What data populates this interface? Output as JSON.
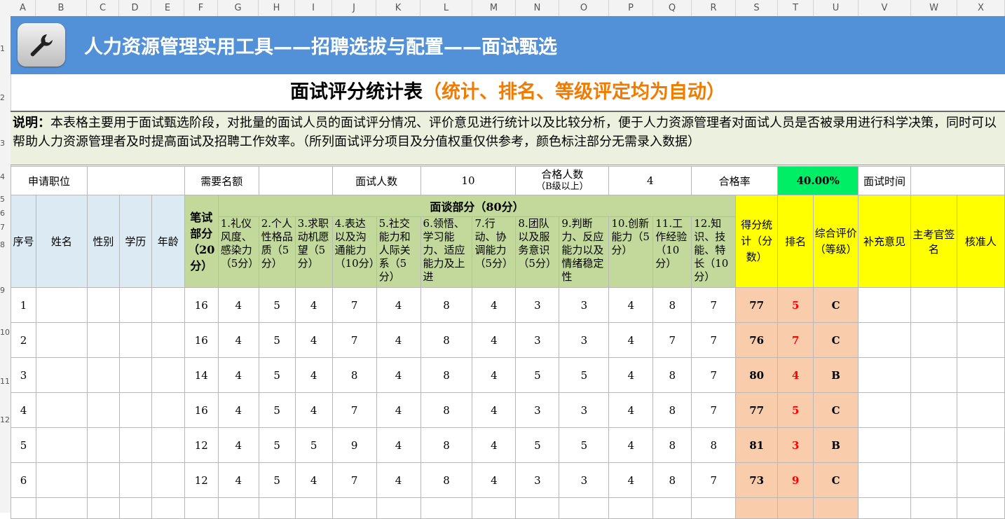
{
  "columns": [
    "A",
    "B",
    "C",
    "D",
    "E",
    "F",
    "G",
    "H",
    "I",
    "J",
    "K",
    "L",
    "M",
    "N",
    "O",
    "P",
    "Q",
    "R",
    "S",
    "T",
    "U",
    "V",
    "W",
    "X"
  ],
  "row_numbers": [
    "1",
    "2",
    "3",
    "4",
    "5",
    "6",
    "7",
    "8",
    "9",
    "10",
    "11",
    "12"
  ],
  "banner_title": "人力资源管理实用工具——招聘选拔与配置——面试甄选",
  "sheet_title": {
    "main": "面试评分统计表",
    "sub": "（统计、排名、等级评定均为自动）"
  },
  "note": {
    "label": "说明：",
    "text": "本表格主要用于面试甄选阶段，对批量的面试人员的面试评分情况、评价意见进行统计以及比较分析，便于人力资源管理者对面试人员是否被录用进行科学决策，同时可以帮助人力资源管理者及时提高面试及招聘工作效率。（所列面试评分项目及分值权重仅供参考，颜色标注部分无需录入数据）"
  },
  "info": {
    "position_label": "申请职位",
    "position_value": "",
    "quota_label": "需要名额",
    "quota_value": "",
    "count_label": "面试人数",
    "count_value": "10",
    "pass_label_1": "合格人数",
    "pass_label_2": "（B级以上）",
    "pass_value": "4",
    "rate_label": "合格率",
    "rate_value": "40.00%",
    "time_label": "面试时间",
    "time_value": ""
  },
  "headers": {
    "seq": "序号",
    "name": "姓名",
    "gender": "性别",
    "edu": "学历",
    "age": "年龄",
    "written": "笔试部分（20分）",
    "interview": "面谈部分（80分）",
    "items": [
      "1.礼仪风度、感染力（5分）",
      "2.个人性格品质（5分）",
      "3.求职动机愿望（5分）",
      "4.表达以及沟通能力（10分）",
      "5.社交能力和人际关系（5分）",
      "6.领悟、学习能力、适应能力及上进",
      "7.行动、协调能力（5分）",
      "8.团队以及服务意识（5分）",
      "9.判断力、反应能力以及情绪稳定性",
      "10.创新能力（5分）",
      "11.工作经验（10分）",
      "12.知识、技能、特长（10分）"
    ],
    "total": "得分统计（分数）",
    "rank": "排名",
    "grade": "综合评价（等级）",
    "extra": "补充意见",
    "examiner": "主考官签名",
    "approver": "核准人"
  },
  "rows": [
    {
      "seq": "1",
      "written": "16",
      "scores": [
        "4",
        "5",
        "4",
        "7",
        "4",
        "8",
        "4",
        "3",
        "3",
        "4",
        "8",
        "7"
      ],
      "total": "77",
      "rank": "5",
      "grade": "C"
    },
    {
      "seq": "2",
      "written": "16",
      "scores": [
        "4",
        "5",
        "4",
        "7",
        "4",
        "8",
        "4",
        "3",
        "3",
        "4",
        "7",
        "7"
      ],
      "total": "76",
      "rank": "7",
      "grade": "C"
    },
    {
      "seq": "3",
      "written": "14",
      "scores": [
        "4",
        "5",
        "4",
        "8",
        "4",
        "8",
        "4",
        "5",
        "5",
        "4",
        "8",
        "7"
      ],
      "total": "80",
      "rank": "4",
      "grade": "B"
    },
    {
      "seq": "4",
      "written": "16",
      "scores": [
        "4",
        "5",
        "4",
        "7",
        "4",
        "8",
        "4",
        "3",
        "3",
        "4",
        "8",
        "7"
      ],
      "total": "77",
      "rank": "5",
      "grade": "C"
    },
    {
      "seq": "5",
      "written": "12",
      "scores": [
        "4",
        "5",
        "5",
        "9",
        "4",
        "8",
        "4",
        "5",
        "5",
        "4",
        "8",
        "8"
      ],
      "total": "81",
      "rank": "3",
      "grade": "B"
    },
    {
      "seq": "6",
      "written": "12",
      "scores": [
        "4",
        "5",
        "4",
        "7",
        "4",
        "8",
        "4",
        "3",
        "3",
        "4",
        "8",
        "7"
      ],
      "total": "73",
      "rank": "9",
      "grade": "C"
    }
  ]
}
